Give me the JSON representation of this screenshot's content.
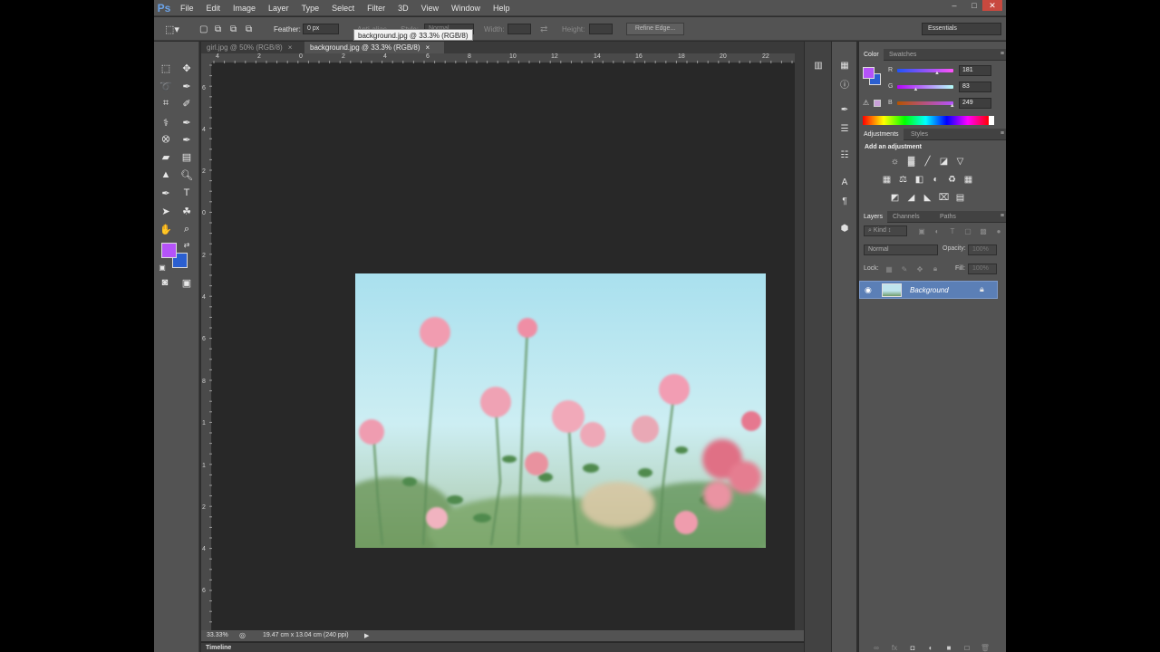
{
  "app": {
    "logo": "Ps",
    "menu": [
      "File",
      "Edit",
      "Image",
      "Layer",
      "Type",
      "Select",
      "Filter",
      "3D",
      "View",
      "Window",
      "Help"
    ],
    "window_controls": [
      "–",
      "□",
      "✕"
    ]
  },
  "options": {
    "feather_label": "Feather:",
    "feather_value": "0 px",
    "antialias_label": "Anti-alias",
    "style_label": "Style:",
    "style_value": "Normal",
    "width_label": "Width:",
    "height_label": "Height:",
    "refine_edge": "Refine Edge...",
    "workspace": "Essentials",
    "tooltip": "background.jpg @ 33.3% (RGB/8)"
  },
  "doc_tabs": [
    {
      "label": "girl.jpg @ 50% (RGB/8)",
      "close": "×"
    },
    {
      "label": "background.jpg @ 33.3% (RGB/8)",
      "close": "×"
    }
  ],
  "ruler": {
    "h": [
      "4",
      "2",
      "0",
      "2",
      "4",
      "6",
      "8",
      "10",
      "12",
      "14",
      "16",
      "18",
      "20",
      "22"
    ],
    "v": [
      "6",
      "4",
      "2",
      "0",
      "2",
      "4",
      "6",
      "8",
      "1",
      "1",
      "2",
      "4",
      "6",
      "8"
    ]
  },
  "status": {
    "zoom": "33.33%",
    "doc_info": "19.47 cm x 13.04 cm (240 ppi)",
    "arrow": "▶"
  },
  "timeline": "Timeline",
  "color_panel": {
    "tabs": [
      "Color",
      "Swatches"
    ],
    "channels": [
      {
        "label": "R",
        "value": "181",
        "fraction": 0.71
      },
      {
        "label": "G",
        "value": "83",
        "fraction": 0.33
      },
      {
        "label": "B",
        "value": "249",
        "fraction": 0.98
      }
    ],
    "foreground": "#b553f9",
    "background": "#2b5fd0"
  },
  "adjustments_panel": {
    "tabs": [
      "Adjustments",
      "Styles"
    ],
    "heading": "Add an adjustment"
  },
  "layers_panel": {
    "tabs": [
      "Layers",
      "Channels",
      "Paths"
    ],
    "kind": "Kind",
    "blend_mode": "Normal",
    "opacity_label": "Opacity:",
    "opacity_value": "100%",
    "lock_label": "Lock:",
    "fill_label": "Fill:",
    "fill_value": "100%",
    "layers": [
      {
        "name": "Background",
        "visible": true,
        "locked": true
      }
    ]
  },
  "colors": {
    "accent_selection": "#5b7fb6"
  }
}
